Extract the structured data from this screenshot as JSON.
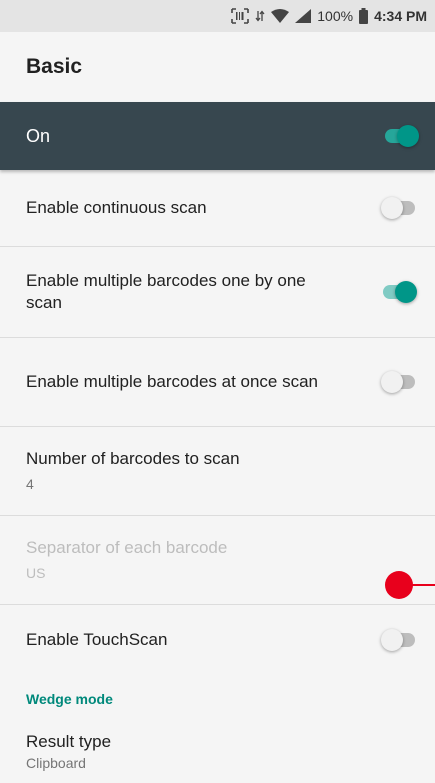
{
  "status_bar": {
    "battery_percent": "100%",
    "time": "4:34 PM",
    "icons": [
      "scanner-icon",
      "data-arrows-icon",
      "wifi-icon",
      "cell-signal-icon",
      "battery-icon"
    ]
  },
  "app_bar": {
    "title": "Basic"
  },
  "master_switch": {
    "label": "On",
    "checked": true
  },
  "settings": {
    "continuous_scan": {
      "title": "Enable continuous scan",
      "checked": false
    },
    "multi_one_by_one": {
      "title": "Enable multiple barcodes one by one scan",
      "checked": true
    },
    "multi_at_once": {
      "title": "Enable multiple barcodes at once scan",
      "checked": false
    },
    "barcode_count": {
      "title": "Number of barcodes to scan",
      "value": "4"
    },
    "separator": {
      "title": "Separator of each barcode",
      "value": "US",
      "enabled": false
    },
    "touchscan": {
      "title": "Enable TouchScan",
      "checked": false
    },
    "wedge_header": "Wedge mode",
    "result_type": {
      "title": "Result type",
      "value": "Clipboard"
    }
  },
  "colors": {
    "accent": "#009688",
    "header_bg": "#37474f",
    "section_header": "#00897b",
    "touch_marker": "#e8001c"
  }
}
